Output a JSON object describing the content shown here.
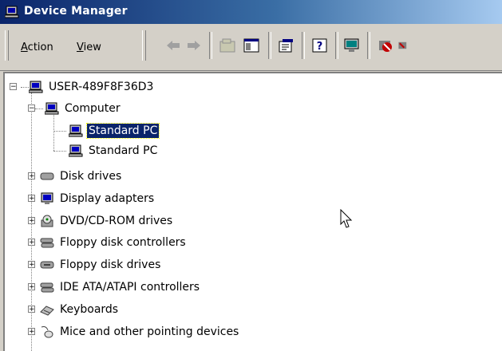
{
  "window": {
    "title": "Device Manager"
  },
  "menu": {
    "action_label": "Action",
    "view_label": "View"
  },
  "toolbar": {
    "buttons": [
      "back-icon",
      "forward-icon",
      "up-folder-icon",
      "show-hide-tree-icon",
      "properties-icon",
      "help-icon",
      "scan-hardware-icon",
      "disable-device-icon"
    ]
  },
  "tree": {
    "root": "USER-489F8F36D3",
    "computer": "Computer",
    "computer_children": [
      "Standard PC",
      "Standard PC"
    ],
    "categories": [
      "Disk drives",
      "Display adapters",
      "DVD/CD-ROM drives",
      "Floppy disk controllers",
      "Floppy disk drives",
      "IDE ATA/ATAPI controllers",
      "Keyboards",
      "Mice and other pointing devices"
    ]
  },
  "colors": {
    "titlebar_start": "#0a246a",
    "titlebar_end": "#a6caf0",
    "selection": "#0a246a"
  }
}
